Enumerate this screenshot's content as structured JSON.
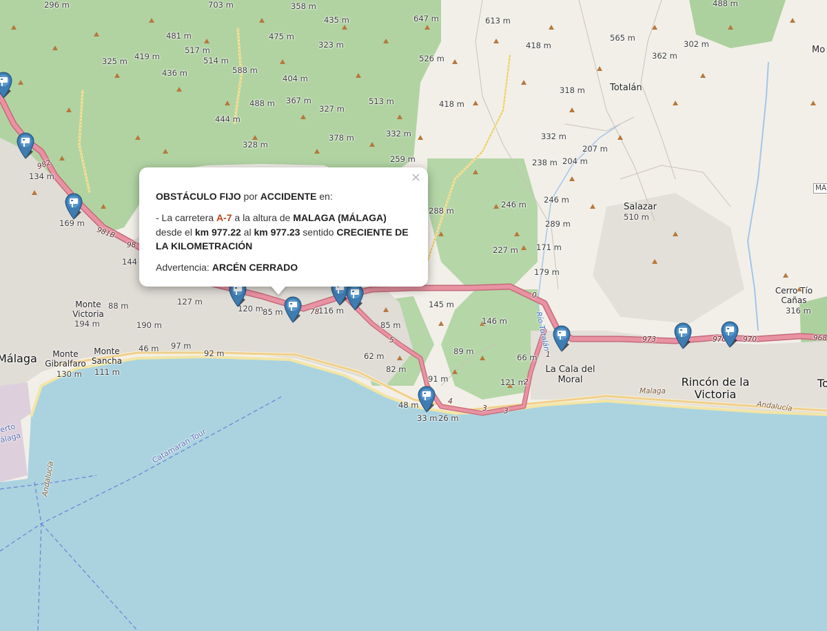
{
  "popup": {
    "close_glyph": "×",
    "obstacle_type": "OBSTÁCULO FIJO",
    "connector_por": " por ",
    "cause": "ACCIDENTE",
    "connector_en": " en:",
    "road_prefix": "- La carretera ",
    "road": "A-7",
    "connector_altura": " a la altura de ",
    "place": "MALAGA (MÁLAGA)",
    "connector_desde": " desde el ",
    "km_from": "km 977.22",
    "connector_al": " al ",
    "km_to": "km 977.23",
    "connector_sentido": " sentido ",
    "direction": "CRECIENTE DE LA KILOMETRACIÓN",
    "warning_label": "Advertencia: ",
    "warning_value": "ARCÉN CERRADO"
  },
  "map_labels": {
    "places": {
      "malaga": "Málaga",
      "totalan": "Totalán",
      "la_cala_del_moral": "La Cala del Moral",
      "rincon_de_la_victoria": "Rincón de la Victoria",
      "salazar": "Salazar",
      "monte_victoria": "Monte Victoria",
      "monte_gibralfaro": "Monte Gibralfaro",
      "monte_sancha": "Monte Sancha",
      "cerro_tio_canas": "Cerro Tío Cañas"
    },
    "elevations": [
      "296 m",
      "703 m",
      "358 m",
      "435 m",
      "647 m",
      "613 m",
      "488 m",
      "481 m",
      "517 m",
      "475 m",
      "323 m",
      "418 m",
      "565 m",
      "302 m",
      "325 m",
      "419 m",
      "514 m",
      "526 m",
      "362 m",
      "436 m",
      "588 m",
      "404 m",
      "318 m",
      "488 m",
      "367 m",
      "327 m",
      "513 m",
      "418 m",
      "444 m",
      "332 m",
      "332 m",
      "378 m",
      "207 m",
      "328 m",
      "259 m",
      "238 m",
      "204 m",
      "134 m",
      "169 m",
      "288 m",
      "246 m",
      "246 m",
      "289 m",
      "510 m",
      "227 m",
      "171 m",
      "179 m",
      "144",
      "88 m",
      "127 m",
      "120 m",
      "85 m",
      "116 m",
      "145 m",
      "194 m",
      "190 m",
      "85 m",
      "146 m",
      "97 m",
      "92 m",
      "46 m",
      "62 m",
      "89 m",
      "66 m",
      "130 m",
      "111 m",
      "82 m",
      "91 m",
      "121 m",
      "48 m",
      "33 m",
      "26 m",
      "316 m"
    ],
    "roads": [
      "982",
      "981B",
      "98",
      "78",
      "5",
      "4",
      "3",
      "3",
      "2",
      "0",
      "973",
      "970",
      "970",
      "968",
      "1",
      "Río Totalán",
      "Malaga",
      "Andalucía",
      "Andalucía"
    ],
    "sea": [
      "Catamaran Tour",
      "erto",
      "álaga"
    ],
    "edge": [
      "Mo",
      "MA",
      "To"
    ]
  },
  "colors": {
    "sea": "#aad3df",
    "land": "#f2efe9",
    "forest": "#add19e",
    "urban": "#e0dcd6",
    "motorway": "#e892a2",
    "popup_road_ref": "#b5451b"
  },
  "markers": {
    "icon": "incident-marker-icon",
    "count": 11
  }
}
